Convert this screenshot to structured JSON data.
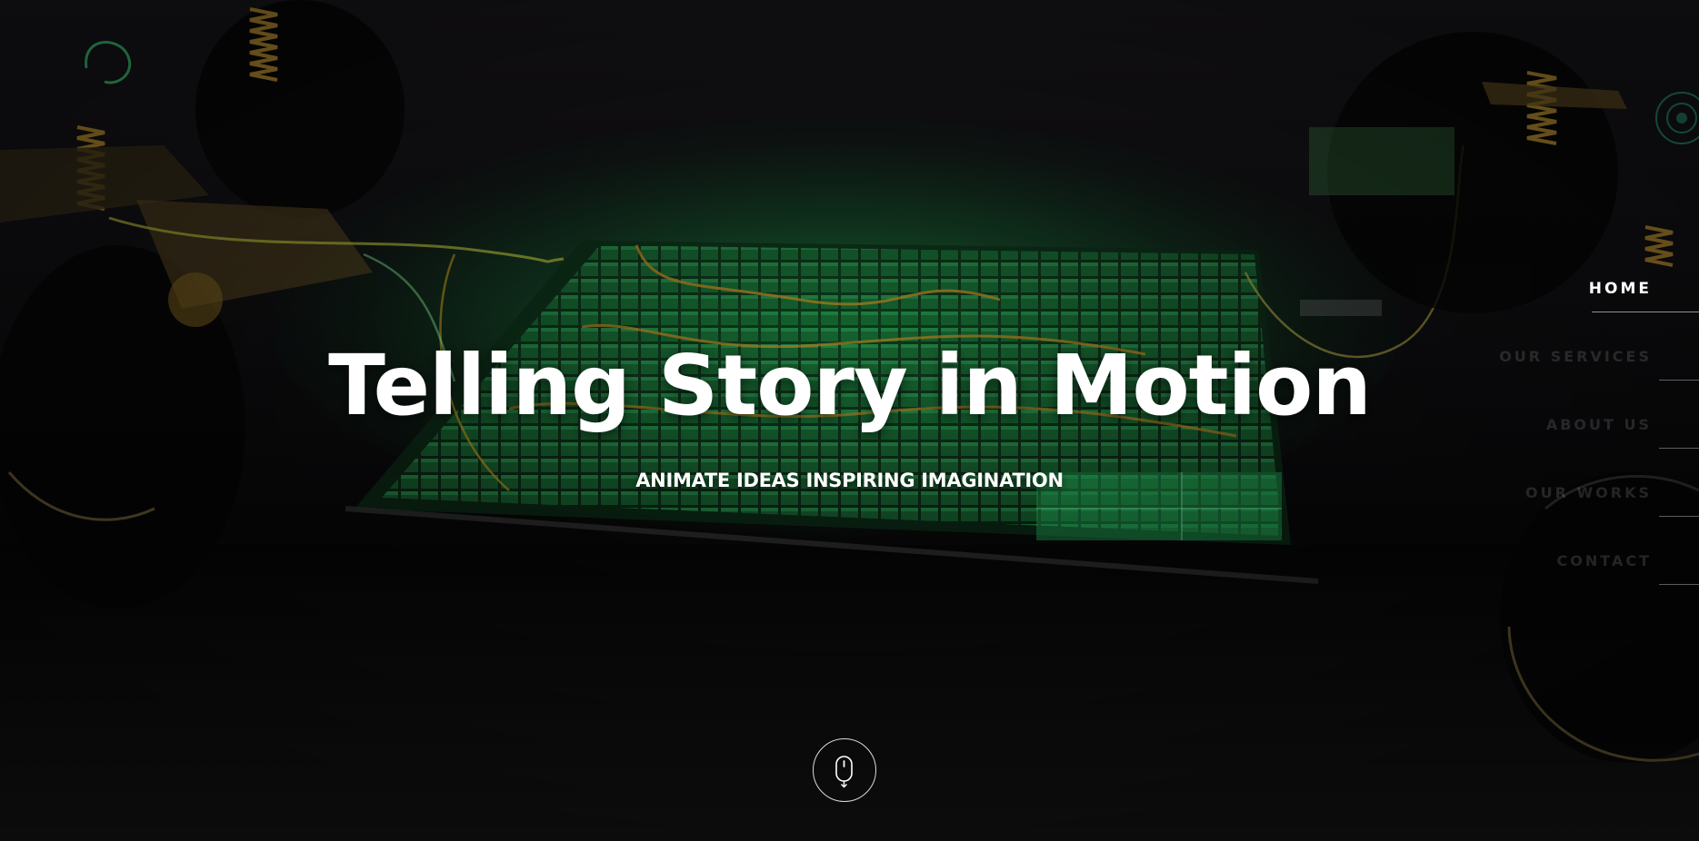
{
  "hero": {
    "title": "Telling Story in Motion",
    "subtitle": "ANIMATE IDEAS INSPIRING IMAGINATION",
    "background": "electric-vehicle-chassis-battery-video",
    "accent_color": "#22c55e"
  },
  "nav": {
    "items": [
      {
        "label": "HOME",
        "active": true
      },
      {
        "label": "OUR SERVICES",
        "active": false
      },
      {
        "label": "ABOUT US",
        "active": false
      },
      {
        "label": "OUR WORKS",
        "active": false
      },
      {
        "label": "CONTACT",
        "active": false
      }
    ]
  },
  "scroll": {
    "icon": "mouse-scroll-icon"
  }
}
